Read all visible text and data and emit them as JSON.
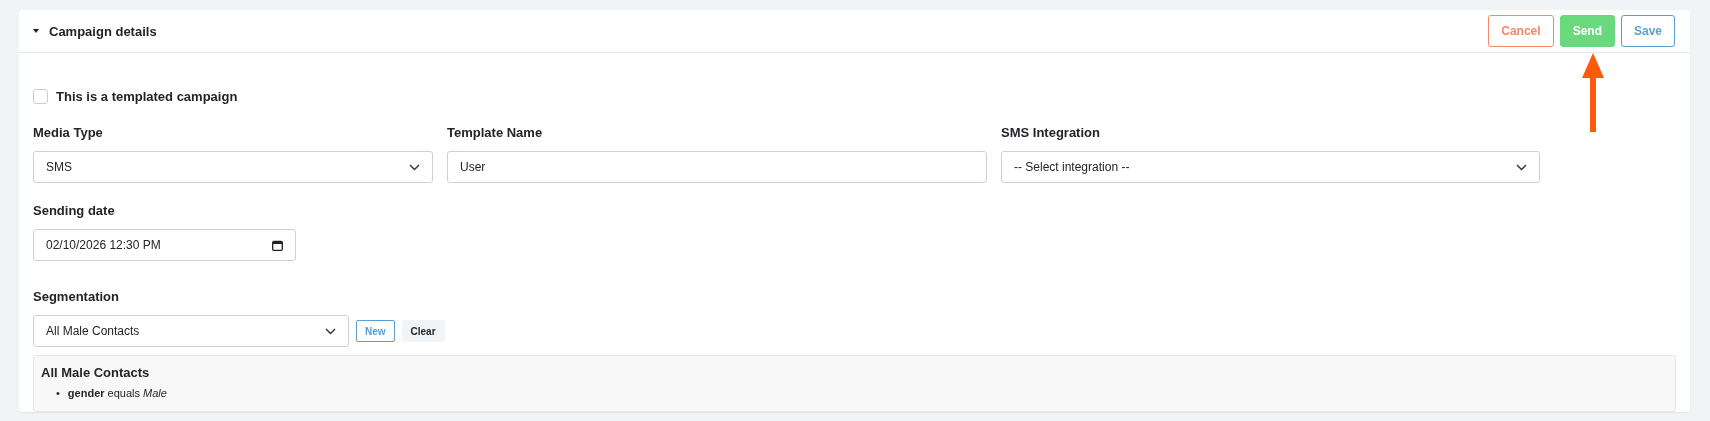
{
  "panel": {
    "title": "Campaign details",
    "expanded": true
  },
  "actions": [
    {
      "label": "Cancel",
      "kind": "cancel"
    },
    {
      "label": "Send",
      "kind": "send"
    },
    {
      "label": "Save",
      "kind": "save"
    }
  ],
  "templated": {
    "label": "This is a templated campaign",
    "checked": false
  },
  "fields": [
    {
      "label": "Media Type",
      "kind": "select",
      "value": "SMS"
    },
    {
      "label": "Template Name",
      "kind": "text",
      "value": "User"
    },
    {
      "label": "SMS Integration",
      "kind": "select",
      "value": "-- Select integration --"
    }
  ],
  "sending_date": {
    "label": "Sending date",
    "value": "02/10/2026 12:30 PM"
  },
  "segmentation": {
    "label": "Segmentation",
    "value": "All Male Contacts",
    "buttons": [
      {
        "label": "New",
        "kind": "outline"
      },
      {
        "label": "Clear",
        "kind": "light"
      }
    ],
    "summary": {
      "title": "All Male Contacts",
      "rules": [
        {
          "marker": "•",
          "text": "**gender** equals *Male*"
        }
      ]
    }
  }
}
